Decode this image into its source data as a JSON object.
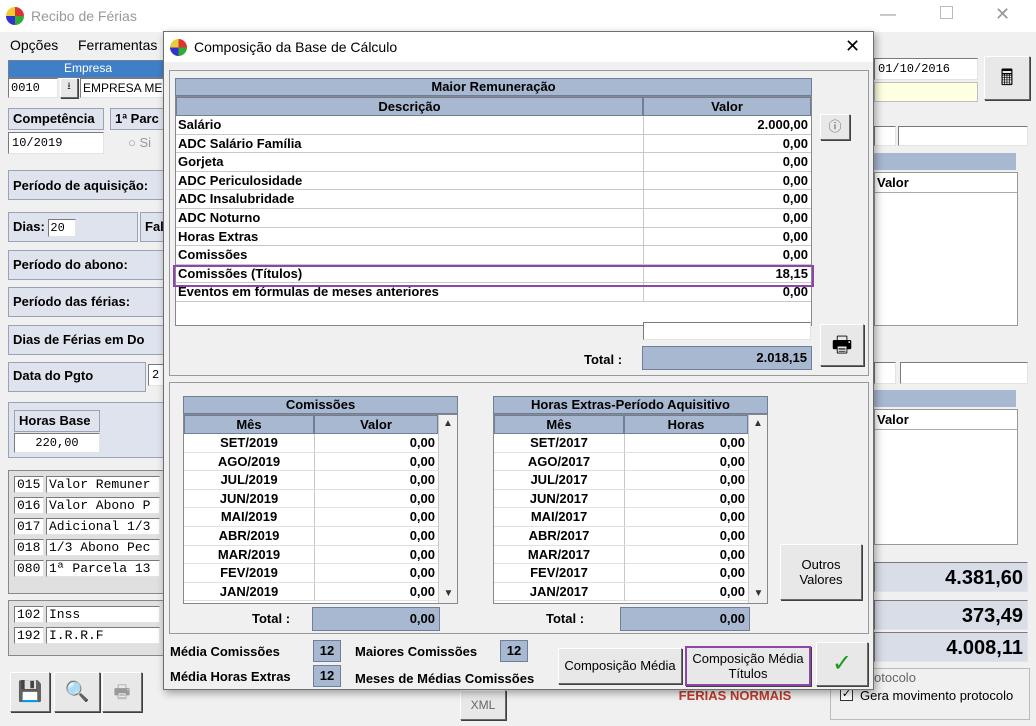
{
  "bg": {
    "window_title": "Recibo de Férias",
    "menu": [
      "Opções",
      "Ferramentas"
    ],
    "empresa_header": "Empresa",
    "empresa_code": "0010",
    "empresa_name": "EMPRESA MEI",
    "date_field": "01/10/2016",
    "competencia_label": "Competência",
    "competencia_value": "10/2019",
    "parcela_label": "1ª Parc",
    "radio_label": "Si",
    "periodo_aquisicao_label": "Período de aquisição:",
    "dias_label": "Dias:",
    "dias_value": "20",
    "faltas_label": "Fal",
    "periodo_abono_label": "Período do abono:",
    "periodo_ferias_label": "Período das férias:",
    "dias_ferias_dobro_label": "Dias de Férias em Do",
    "data_pgto_label": "Data do Pgto",
    "data_pgto_value": "2",
    "horas_base_label": "Horas Base",
    "horas_base_value": "220,00",
    "events": [
      {
        "code": "015",
        "desc": "Valor Remuner"
      },
      {
        "code": "016",
        "desc": "Valor Abono P"
      },
      {
        "code": "017",
        "desc": "Adicional 1/3"
      },
      {
        "code": "018",
        "desc": "1/3 Abono Pec"
      },
      {
        "code": "080",
        "desc": "1ª Parcela 13"
      }
    ],
    "discounts": [
      {
        "code": "102",
        "desc": "Inss"
      },
      {
        "code": "192",
        "desc": "I.R.R.F"
      }
    ],
    "right_col_header_1": "Valor",
    "right_col_header_2": "Valor",
    "total_1": "4.381,60",
    "total_2": "373,49",
    "total_3": "4.008,11",
    "protocolo_group": "otocolo",
    "gera_protocolo_label": "Gera movimento protocolo",
    "ferias_normais": "FÉRIAS NORMAIS",
    "xml_label": "XML"
  },
  "dialog": {
    "title": "Composição da Base de Cálculo",
    "maior_title": "Maior Remuneração",
    "col_descricao": "Descrição",
    "col_valor": "Valor",
    "rows": [
      {
        "desc": "Salário",
        "valor": "2.000,00"
      },
      {
        "desc": "ADC Salário Família",
        "valor": "0,00"
      },
      {
        "desc": "Gorjeta",
        "valor": "0,00"
      },
      {
        "desc": "ADC Periculosidade",
        "valor": "0,00"
      },
      {
        "desc": "ADC Insalubridade",
        "valor": "0,00"
      },
      {
        "desc": "ADC Noturno",
        "valor": "0,00"
      },
      {
        "desc": "Horas Extras",
        "valor": "0,00"
      },
      {
        "desc": "Comissões",
        "valor": "0,00"
      },
      {
        "desc": "Comissões (Títulos)",
        "valor": "18,15"
      },
      {
        "desc": "Eventos em fórmulas de meses anteriores",
        "valor": "0,00"
      }
    ],
    "total_label": "Total :",
    "total_value": "2.018,15",
    "comissoes": {
      "title": "Comissões",
      "col_mes": "Mês",
      "col_valor": "Valor",
      "rows": [
        {
          "mes": "SET/2019",
          "valor": "0,00"
        },
        {
          "mes": "AGO/2019",
          "valor": "0,00"
        },
        {
          "mes": "JUL/2019",
          "valor": "0,00"
        },
        {
          "mes": "JUN/2019",
          "valor": "0,00"
        },
        {
          "mes": "MAI/2019",
          "valor": "0,00"
        },
        {
          "mes": "ABR/2019",
          "valor": "0,00"
        },
        {
          "mes": "MAR/2019",
          "valor": "0,00"
        },
        {
          "mes": "FEV/2019",
          "valor": "0,00"
        },
        {
          "mes": "JAN/2019",
          "valor": "0,00"
        }
      ],
      "total_label": "Total :",
      "total_value": "0,00"
    },
    "horas": {
      "title": "Horas Extras-Período Aquisitivo",
      "col_mes": "Mês",
      "col_horas": "Horas",
      "rows": [
        {
          "mes": "SET/2017",
          "valor": "0,00"
        },
        {
          "mes": "AGO/2017",
          "valor": "0,00"
        },
        {
          "mes": "JUL/2017",
          "valor": "0,00"
        },
        {
          "mes": "JUN/2017",
          "valor": "0,00"
        },
        {
          "mes": "MAI/2017",
          "valor": "0,00"
        },
        {
          "mes": "ABR/2017",
          "valor": "0,00"
        },
        {
          "mes": "MAR/2017",
          "valor": "0,00"
        },
        {
          "mes": "FEV/2017",
          "valor": "0,00"
        },
        {
          "mes": "JAN/2017",
          "valor": "0,00"
        }
      ],
      "total_label": "Total :",
      "total_value": "0,00"
    },
    "outros_valores": "Outros Valores",
    "media_comissoes_label": "Média Comissões",
    "media_comissoes_value": "12",
    "media_horas_label": "Média Horas Extras",
    "media_horas_value": "12",
    "maiores_comissoes_label": "Maiores Comissões",
    "maiores_comissoes_value": "12",
    "meses_medias_label": "Meses de Médias Comissões",
    "btn_composicao_media": "Composição Média",
    "btn_composicao_titulos": "Composição Média Títulos",
    "ok_symbol": "✓",
    "close_symbol": "✕"
  },
  "colors": {
    "header_blue": "#a8b8d0",
    "highlight_purple": "#8e44ad",
    "ok_green": "#1a9a1a",
    "ferias_red": "#c0392b"
  }
}
